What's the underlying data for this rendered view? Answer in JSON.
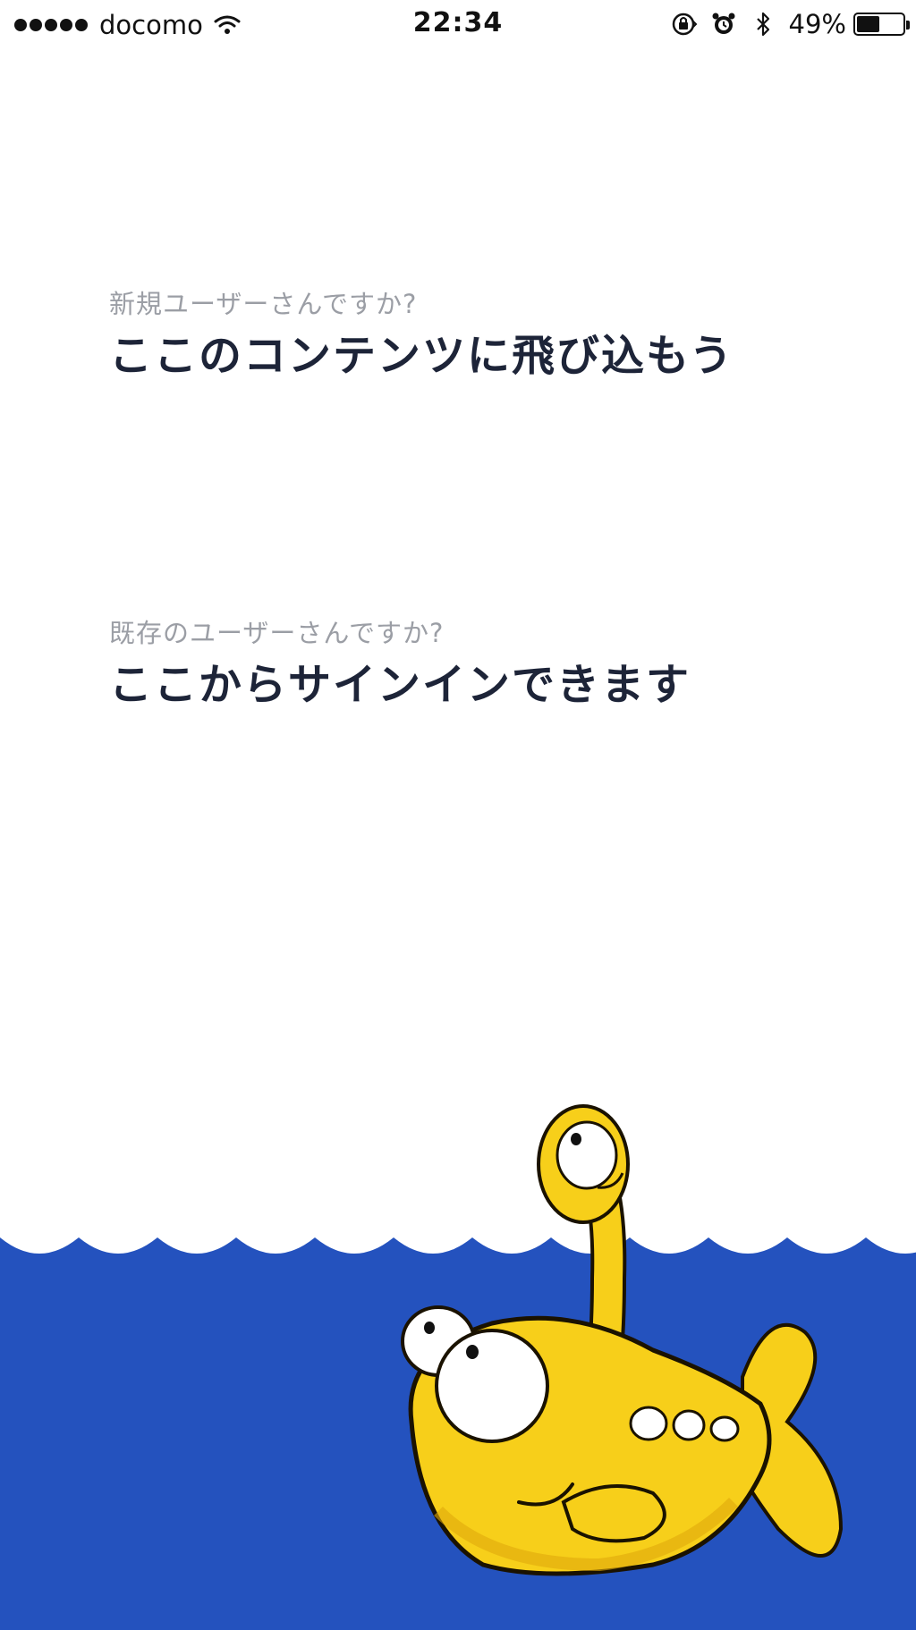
{
  "status_bar": {
    "carrier": "docomo",
    "time": "22:34",
    "battery_percent": "49%",
    "battery_level": 0.49,
    "icons": [
      "signal-dots-icon",
      "wifi-icon",
      "orientation-lock-icon",
      "alarm-icon",
      "bluetooth-icon",
      "battery-icon"
    ]
  },
  "new_user": {
    "question": "新規ユーザーさんですか?",
    "action": "ここのコンテンツに飛び込もう"
  },
  "existing_user": {
    "question": "既存のユーザーさんですか?",
    "action": "ここからサインインできます"
  },
  "illustration": {
    "name": "yellow-submarine-fish-mascot",
    "water_color": "#2452be",
    "mascot_color": "#f7cf1a"
  },
  "colors": {
    "background": "#ffffff",
    "question_text": "#9b9ea5",
    "action_text": "#1d2438"
  }
}
